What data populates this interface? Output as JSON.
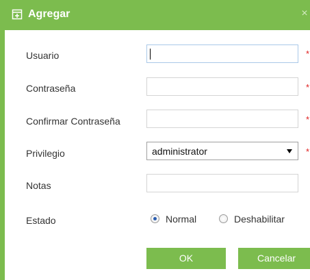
{
  "dialog": {
    "title": "Agregar",
    "title_icon": "add-form-icon",
    "close_symbol": "×",
    "accent_color": "#7cbc4e"
  },
  "form": {
    "usuario_label": "Usuario",
    "usuario_value": "",
    "contrasena_label": "Contraseña",
    "contrasena_value": "",
    "confirmar_label": "Confirmar Contraseña",
    "confirmar_value": "",
    "privilegio_label": "Privilegio",
    "privilegio_selected": "administrator",
    "notas_label": "Notas",
    "notas_value": "",
    "estado_label": "Estado",
    "required_mark": "*",
    "estado_options": [
      {
        "label": "Normal",
        "selected": true
      },
      {
        "label": "Deshabilitar",
        "selected": false
      }
    ]
  },
  "buttons": {
    "ok_label": "OK",
    "cancel_label": "Cancelar"
  }
}
